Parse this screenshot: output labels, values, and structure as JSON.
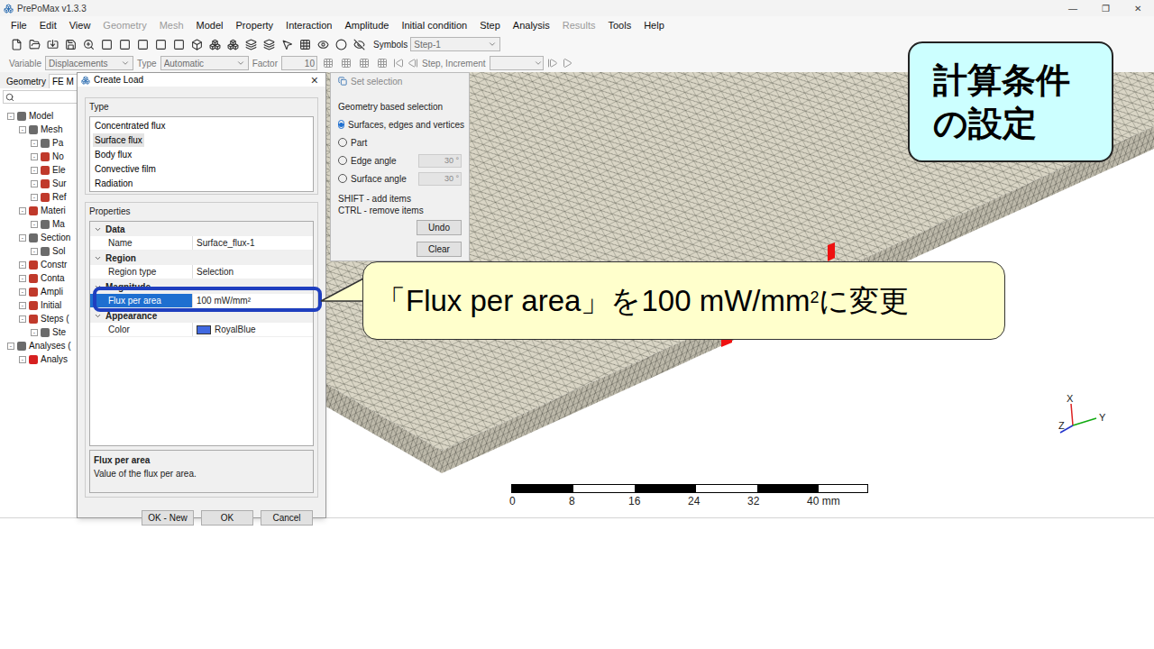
{
  "window": {
    "title": "PrePoMax v1.3.3",
    "controls": [
      "—",
      "❐",
      "✕"
    ]
  },
  "menu": [
    {
      "label": "File",
      "disabled": false
    },
    {
      "label": "Edit",
      "disabled": false
    },
    {
      "label": "View",
      "disabled": false
    },
    {
      "label": "Geometry",
      "disabled": true
    },
    {
      "label": "Mesh",
      "disabled": true
    },
    {
      "label": "Model",
      "disabled": false
    },
    {
      "label": "Property",
      "disabled": false
    },
    {
      "label": "Interaction",
      "disabled": false
    },
    {
      "label": "Amplitude",
      "disabled": false
    },
    {
      "label": "Initial condition",
      "disabled": false
    },
    {
      "label": "Step",
      "disabled": false
    },
    {
      "label": "Analysis",
      "disabled": false
    },
    {
      "label": "Results",
      "disabled": true
    },
    {
      "label": "Tools",
      "disabled": false
    },
    {
      "label": "Help",
      "disabled": false
    }
  ],
  "toolbar": {
    "symbols_label": "Symbols",
    "symbols_value": "Step-1",
    "variable_label": "Variable",
    "variable_value": "Displacements",
    "type_label": "Type",
    "type_value": "Automatic",
    "factor_label": "Factor",
    "factor_value": "10",
    "step_label": "Step, Increment"
  },
  "tree": {
    "tabs": [
      {
        "label": "Geometry",
        "selected": false
      },
      {
        "label": "FE M",
        "selected": true
      }
    ],
    "items": [
      {
        "label": "Model",
        "level": 0,
        "color": "#6b6b6b"
      },
      {
        "label": "Mesh",
        "level": 1,
        "color": "#6b6b6b"
      },
      {
        "label": "Pa",
        "level": 2,
        "color": "#6b6b6b"
      },
      {
        "label": "No",
        "level": 2,
        "color": "#c0392b"
      },
      {
        "label": "Ele",
        "level": 2,
        "color": "#c0392b"
      },
      {
        "label": "Sur",
        "level": 2,
        "color": "#c0392b"
      },
      {
        "label": "Ref",
        "level": 2,
        "color": "#c0392b"
      },
      {
        "label": "Materi",
        "level": 1,
        "color": "#c0392b"
      },
      {
        "label": "Ma",
        "level": 2,
        "color": "#6b6b6b"
      },
      {
        "label": "Section",
        "level": 1,
        "color": "#6b6b6b"
      },
      {
        "label": "Sol",
        "level": 2,
        "color": "#6b6b6b"
      },
      {
        "label": "Constr",
        "level": 1,
        "color": "#c0392b"
      },
      {
        "label": "Conta",
        "level": 1,
        "color": "#c0392b"
      },
      {
        "label": "Ampli",
        "level": 1,
        "color": "#c0392b"
      },
      {
        "label": "Initial",
        "level": 1,
        "color": "#c0392b"
      },
      {
        "label": "Steps (",
        "level": 1,
        "color": "#c0392b"
      },
      {
        "label": "Ste",
        "level": 2,
        "color": "#6b6b6b"
      },
      {
        "label": "Analyses (",
        "level": 0,
        "color": "#6b6b6b"
      },
      {
        "label": "Analys",
        "level": 1,
        "color": "#d62020"
      }
    ]
  },
  "create_load": {
    "title": "Create Load",
    "close": "×",
    "type_header": "Type",
    "types": [
      {
        "label": "Concentrated flux",
        "selected": false
      },
      {
        "label": "Surface flux",
        "selected": true
      },
      {
        "label": "Body flux",
        "selected": false
      },
      {
        "label": "Convective film",
        "selected": false
      },
      {
        "label": "Radiation",
        "selected": false
      }
    ],
    "properties_header": "Properties",
    "groups": [
      {
        "label": "Data",
        "rows": [
          {
            "key": "Name",
            "value": "Surface_flux-1",
            "selected": false
          }
        ]
      },
      {
        "label": "Region",
        "rows": [
          {
            "key": "Region type",
            "value": "Selection",
            "selected": false
          }
        ]
      },
      {
        "label": "Magnitude",
        "rows": [
          {
            "key": "Flux per area",
            "value": "100 mW/mm²",
            "selected": true
          }
        ]
      },
      {
        "label": "Appearance",
        "rows": [
          {
            "key": "Color",
            "value": "RoyalBlue",
            "selected": false,
            "swatch": "#4169e1"
          }
        ]
      }
    ],
    "description": {
      "title": "Flux per area",
      "text": "Value of the flux per area."
    },
    "buttons": [
      "OK - New",
      "OK",
      "Cancel"
    ]
  },
  "set_selection": {
    "title": "Set selection",
    "group": "Geometry based selection",
    "options": [
      {
        "label": "Surfaces, edges and vertices",
        "selected": true,
        "value": ""
      },
      {
        "label": "Part",
        "selected": false,
        "value": ""
      },
      {
        "label": "Edge angle",
        "selected": false,
        "value": "30 °"
      },
      {
        "label": "Surface angle",
        "selected": false,
        "value": "30 °"
      }
    ],
    "hints": [
      "SHIFT - add items",
      "CTRL - remove items"
    ],
    "buttons": [
      "Undo",
      "Clear"
    ]
  },
  "scale_bar": {
    "ticks": [
      "0",
      "8",
      "16",
      "24",
      "32",
      "40 mm"
    ]
  },
  "axes": [
    "X",
    "Y",
    "Z"
  ],
  "callouts": {
    "title_lines": [
      "計算条件",
      "の設定"
    ],
    "note": {
      "before": "「Flux per area」を100 mW/mm",
      "sup": "2",
      "after": "に変更"
    }
  }
}
